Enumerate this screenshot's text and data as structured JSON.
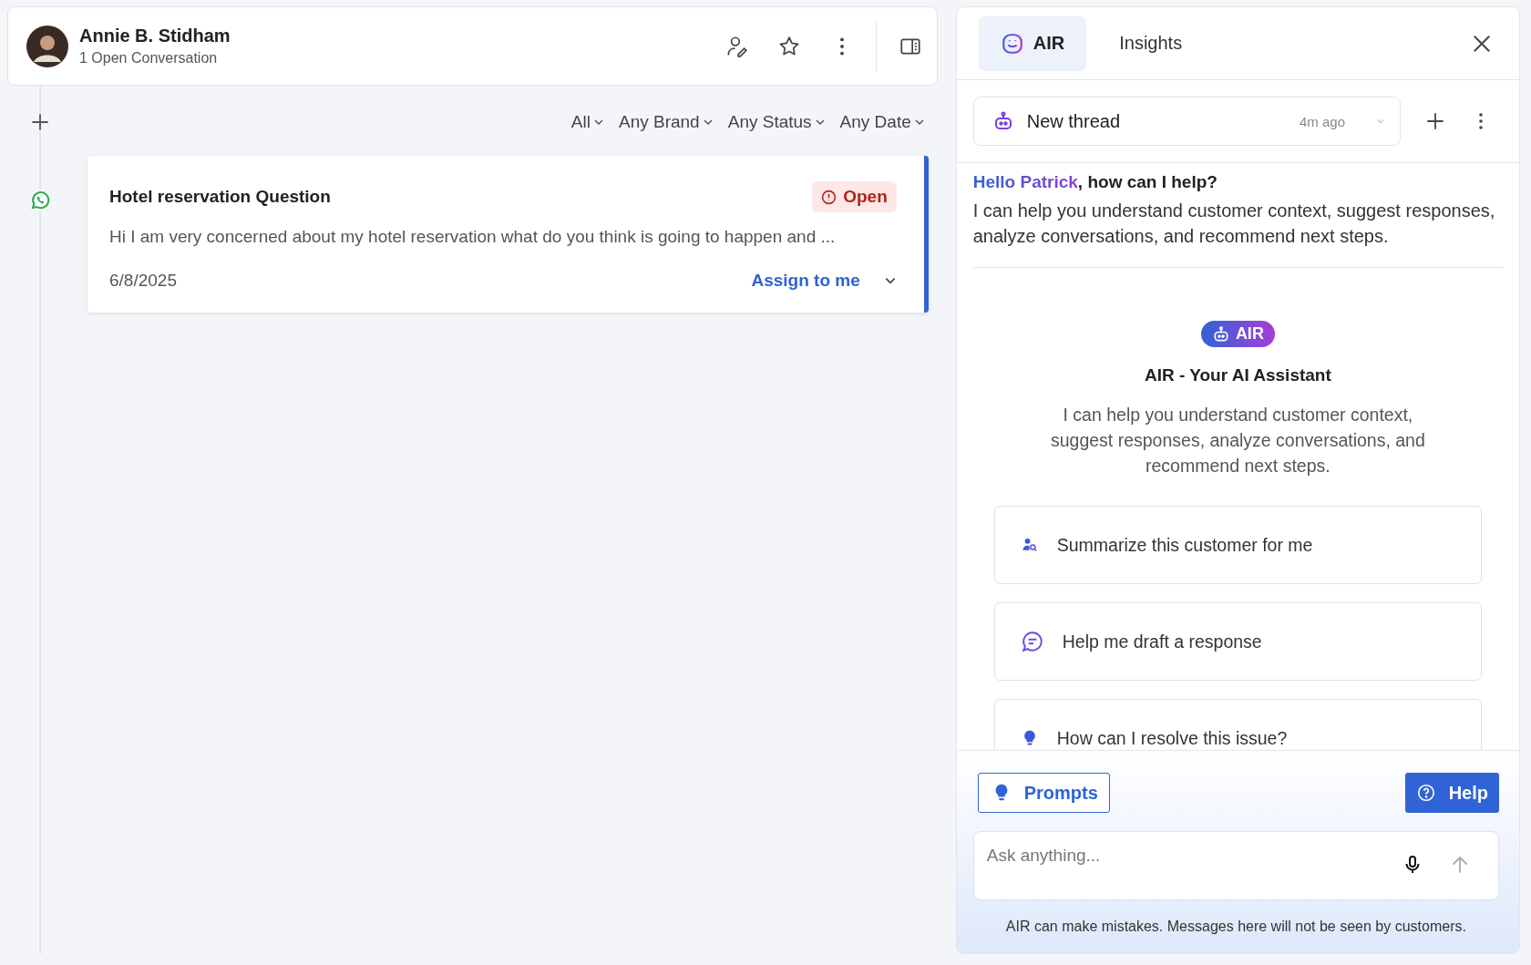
{
  "contact": {
    "name": "Annie B. Stidham",
    "subtitle": "1 Open Conversation"
  },
  "filters": [
    {
      "label": "All"
    },
    {
      "label": "Any Brand"
    },
    {
      "label": "Any Status"
    },
    {
      "label": "Any Date"
    }
  ],
  "conversation": {
    "title": "Hotel reservation Question",
    "status": "Open",
    "preview": "Hi I am very concerned about my hotel reservation what do you think is going to happen and ...",
    "date": "6/8/2025",
    "assign": "Assign to me",
    "selected": true
  },
  "tabs": [
    {
      "label": "AIR",
      "selected": true
    },
    {
      "label": "Insights",
      "selected": false
    }
  ],
  "thread": {
    "title": "New thread",
    "time": "4m ago"
  },
  "greeting": {
    "name": "Hello Patrick",
    "rest": ", how can I help?",
    "text": "I can help you understand customer context, suggest responses, analyze conversations, and recommend next steps."
  },
  "intro": {
    "badge": "AIR",
    "title": "AIR - Your AI Assistant",
    "text": "I can help you understand customer context, suggest responses, analyze conversations, and recommend next steps."
  },
  "suggestions": [
    {
      "kind": "person",
      "label": "Summarize this customer for me"
    },
    {
      "kind": "chat",
      "label": "Help me draft a response"
    },
    {
      "kind": "bulb",
      "label": "How can I resolve this issue?"
    }
  ],
  "prompts_button": "Prompts",
  "help_button": "Help",
  "input": {
    "placeholder": "Ask anything..."
  },
  "disclaimer": "AIR can make mistakes. Messages here will not be seen by customers."
}
